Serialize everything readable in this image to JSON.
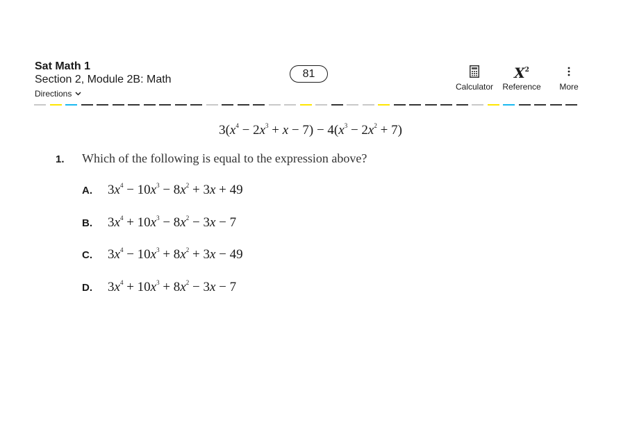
{
  "header": {
    "test_title": "Sat Math 1",
    "section_title": "Section 2, Module 2B: Math",
    "directions_label": "Directions",
    "question_number_badge": "81"
  },
  "tools": [
    {
      "label": "Calculator",
      "icon": "calculator-icon"
    },
    {
      "label": "Reference",
      "icon": "reference-icon",
      "glyph": "X",
      "glyph_sup": "2"
    },
    {
      "label": "More",
      "icon": "more-vertical-icon",
      "glyph": "⋮"
    }
  ],
  "progress": {
    "colors": {
      "gray": "#c8c8c8",
      "yellow": "#ffe600",
      "blue": "#1ab8f0",
      "dark": "#333333"
    },
    "segments": [
      "gray",
      "yellow",
      "blue",
      "dark",
      "dark",
      "dark",
      "dark",
      "dark",
      "dark",
      "dark",
      "dark",
      "gray",
      "dark",
      "dark",
      "dark",
      "gray",
      "gray",
      "yellow",
      "gray",
      "dark",
      "gray",
      "gray",
      "yellow",
      "dark",
      "dark",
      "dark",
      "dark",
      "dark",
      "gray",
      "yellow",
      "blue",
      "dark",
      "dark",
      "dark",
      "dark"
    ]
  },
  "question": {
    "expression_html": "3(<i>x</i><sup>4</sup> − 2<i>x</i><sup>3</sup> + <i>x</i> − 7) − 4(<i>x</i><sup>3</sup> − 2<i>x</i><sup>2</sup> + 7)",
    "expression_text": "3(x^4 − 2x^3 + x − 7) − 4(x^3 − 2x^2 + 7)",
    "number": "1.",
    "prompt": "Which of the following is equal to the expression above?",
    "choices": [
      {
        "letter": "A.",
        "text": "3x^4 − 10x^3 − 8x^2 + 3x + 49",
        "html": "3<i>x</i><sup>4</sup> − 10<i>x</i><sup>3</sup> − 8<i>x</i><sup>2</sup> + 3<i>x</i> + 49"
      },
      {
        "letter": "B.",
        "text": "3x^4 + 10x^3 − 8x^2 − 3x − 7",
        "html": "3<i>x</i><sup>4</sup> + 10<i>x</i><sup>3</sup> − 8<i>x</i><sup>2</sup> − 3<i>x</i> − 7"
      },
      {
        "letter": "C.",
        "text": "3x^4 − 10x^3 + 8x^2 + 3x − 49",
        "html": "3<i>x</i><sup>4</sup> − 10<i>x</i><sup>3</sup> + 8<i>x</i><sup>2</sup> + 3<i>x</i> − 49"
      },
      {
        "letter": "D.",
        "text": "3x^4 + 10x^3 + 8x^2 − 3x − 7",
        "html": "3<i>x</i><sup>4</sup> + 10<i>x</i><sup>3</sup> + 8<i>x</i><sup>2</sup> − 3<i>x</i> − 7"
      }
    ]
  }
}
